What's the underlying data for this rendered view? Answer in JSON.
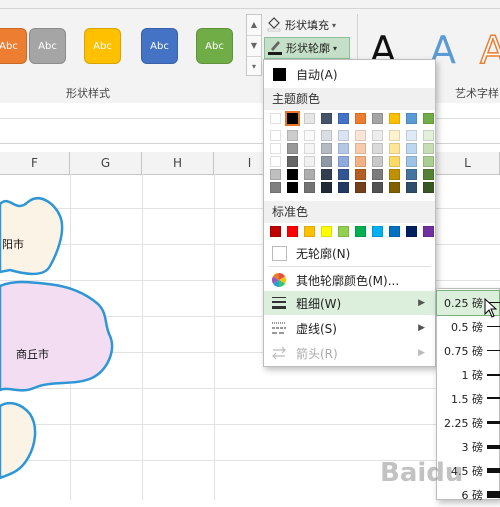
{
  "ribbon": {
    "gallery_swatches": [
      {
        "label": "Abc",
        "color": "#ed7d31"
      },
      {
        "label": "Abc",
        "color": "#a5a5a5"
      },
      {
        "label": "Abc",
        "color": "#ffc000"
      },
      {
        "label": "Abc",
        "color": "#4472c4"
      },
      {
        "label": "Abc",
        "color": "#70ad47"
      }
    ],
    "group_shape_styles": "形状样式",
    "shape_fill": "形状填充",
    "shape_outline": "形状轮廓",
    "wordart_group_label": "艺术字样",
    "wordart_glyph": "A"
  },
  "columns": [
    "F",
    "G",
    "H",
    "I",
    "L"
  ],
  "map_labels": {
    "city1": "阳市",
    "city2": "商丘市"
  },
  "outline_menu": {
    "auto": "自动(A)",
    "theme_colors_header": "主题颜色",
    "standard_colors_header": "标准色",
    "no_outline": "无轮廓(N)",
    "more_colors": "其他轮廓颜色(M)...",
    "weight": "粗细(W)",
    "dashes": "虚线(S)",
    "arrows": "箭头(R)",
    "theme_colors": [
      "#ffffff",
      "#000000",
      "#e7e6e6",
      "#44546a",
      "#4472c4",
      "#ed7d31",
      "#a5a5a5",
      "#ffc000",
      "#5b9bd5",
      "#70ad47"
    ],
    "standard_colors": [
      "#c00000",
      "#ff0000",
      "#ffc000",
      "#ffff00",
      "#92d050",
      "#00b050",
      "#00b0f0",
      "#0070c0",
      "#002060",
      "#7030a0"
    ]
  },
  "weight_submenu": {
    "items": [
      "0.25 磅",
      "0.5 磅",
      "0.75 磅",
      "1 磅",
      "1.5 磅",
      "2.25 磅",
      "3 磅",
      "4.5 磅",
      "6 磅"
    ]
  },
  "watermark": "Baidu"
}
